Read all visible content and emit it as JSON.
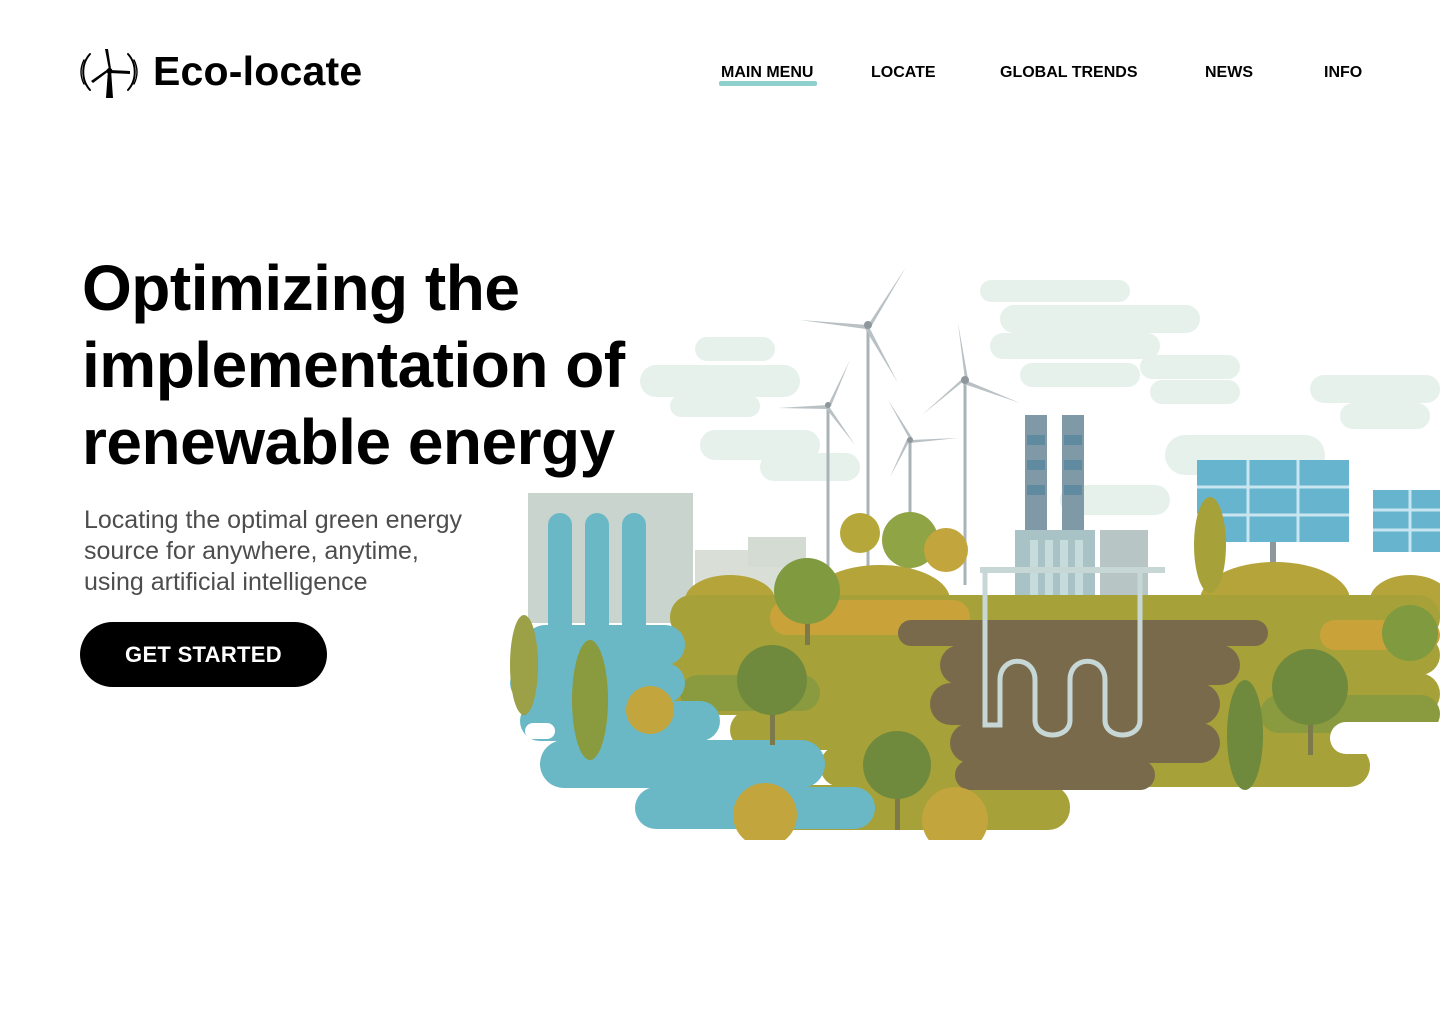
{
  "header": {
    "brand": "Eco-locate",
    "logo_icon": "wind-turbine-icon"
  },
  "nav": {
    "items": [
      {
        "label": "MAIN MENU",
        "active": true
      },
      {
        "label": "LOCATE",
        "active": false
      },
      {
        "label": "GLOBAL TRENDS",
        "active": false
      },
      {
        "label": "NEWS",
        "active": false
      },
      {
        "label": "INFO",
        "active": false
      }
    ],
    "active_underline_color": "#8fd0cd"
  },
  "hero": {
    "title_lines": [
      "Optimizing the",
      "implementation of",
      "renewable energy"
    ],
    "subtitle_lines": [
      "Locating the optimal green energy",
      "source for anywhere, anytime,",
      "using artificial intelligence"
    ],
    "cta_label": "GET STARTED",
    "illustration_icon": "green-energy-landscape-illustration"
  },
  "colors": {
    "text": "#000000",
    "subtitle": "#4d4d4d",
    "button_bg": "#000000",
    "button_text": "#ffffff",
    "water": "#6ab8c6",
    "grass": "#a7a13a",
    "soil": "#7a6a4c",
    "tree": "#6f8a3c",
    "smoke": "#e3efe9",
    "solar_panel": "#67b4cf"
  }
}
